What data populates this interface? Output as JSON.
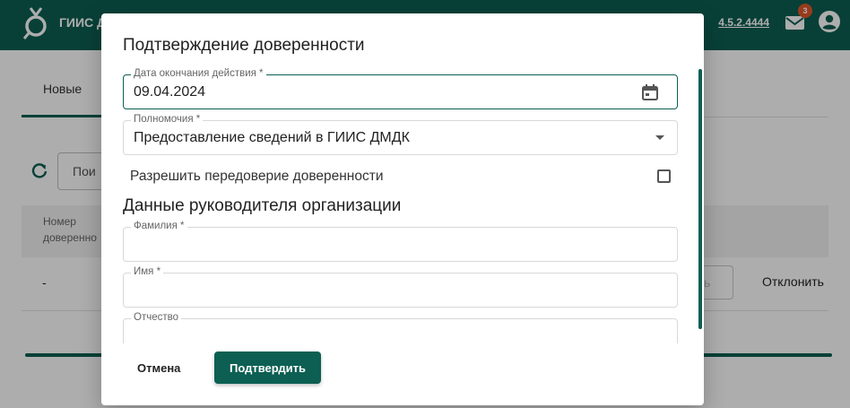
{
  "app": {
    "title": "ГИИС Д",
    "version": "4.5.2.4444",
    "mail_badge": "3",
    "brand_color": "#0c5f52"
  },
  "background": {
    "tab_label": "Новые",
    "search_placeholder": "Пои",
    "table_header": "Номер доверенно",
    "row_number": "-",
    "accept_fragment": "ь",
    "reject_label": "Отклонить"
  },
  "dialog": {
    "title": "Подтверждение доверенности",
    "end_date": {
      "label": "Дата окончания действия *",
      "value": "09.04.2024"
    },
    "powers": {
      "label": "Полномочия *",
      "value": "Предоставление сведений в ГИИС ДМДК"
    },
    "allow_redelegation_label": "Разрешить передоверие доверенности",
    "section_title": "Данные руководителя организации",
    "last_name": {
      "label": "Фамилия *",
      "value": ""
    },
    "first_name": {
      "label": "Имя *",
      "value": ""
    },
    "middle_name": {
      "label": "Отчество",
      "value": ""
    },
    "cancel_label": "Отмена",
    "confirm_label": "Подтвердить"
  },
  "icons": {
    "logo": "ring-logo-icon",
    "mail": "mail-icon",
    "account": "account-circle-icon",
    "refresh": "refresh-icon",
    "calendar": "calendar-icon",
    "dropdown": "arrow-drop-down-icon",
    "pager": [
      "first-page-icon",
      "chevron-left-icon",
      "chevron-right-icon",
      "last-page-icon"
    ]
  }
}
